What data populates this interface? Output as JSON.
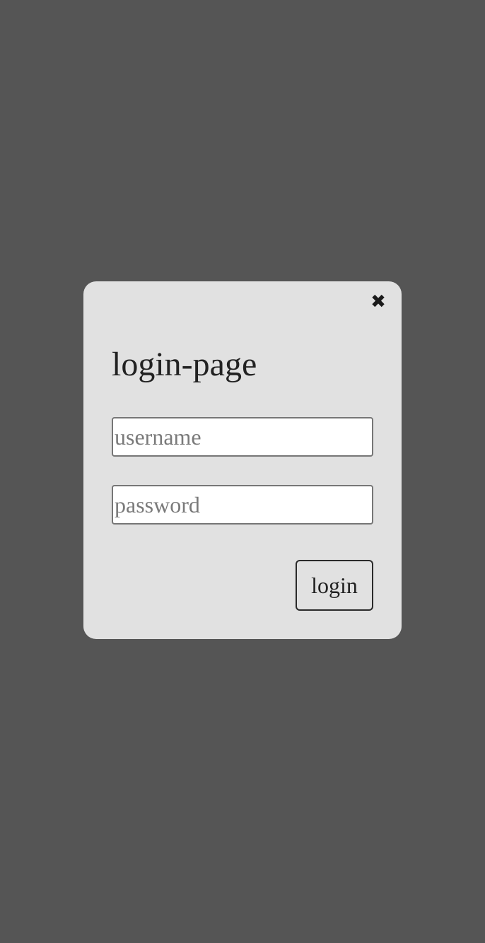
{
  "modal": {
    "title": "login-page",
    "close_icon": "close-icon",
    "close_glyph": "✖",
    "username_placeholder": "username",
    "username_value": "",
    "password_placeholder": "password",
    "password_value": "",
    "login_label": "login"
  },
  "colors": {
    "backdrop": "#555555",
    "modal_bg": "#e1e1e1",
    "text": "#222222",
    "placeholder": "#7a7a7a"
  }
}
